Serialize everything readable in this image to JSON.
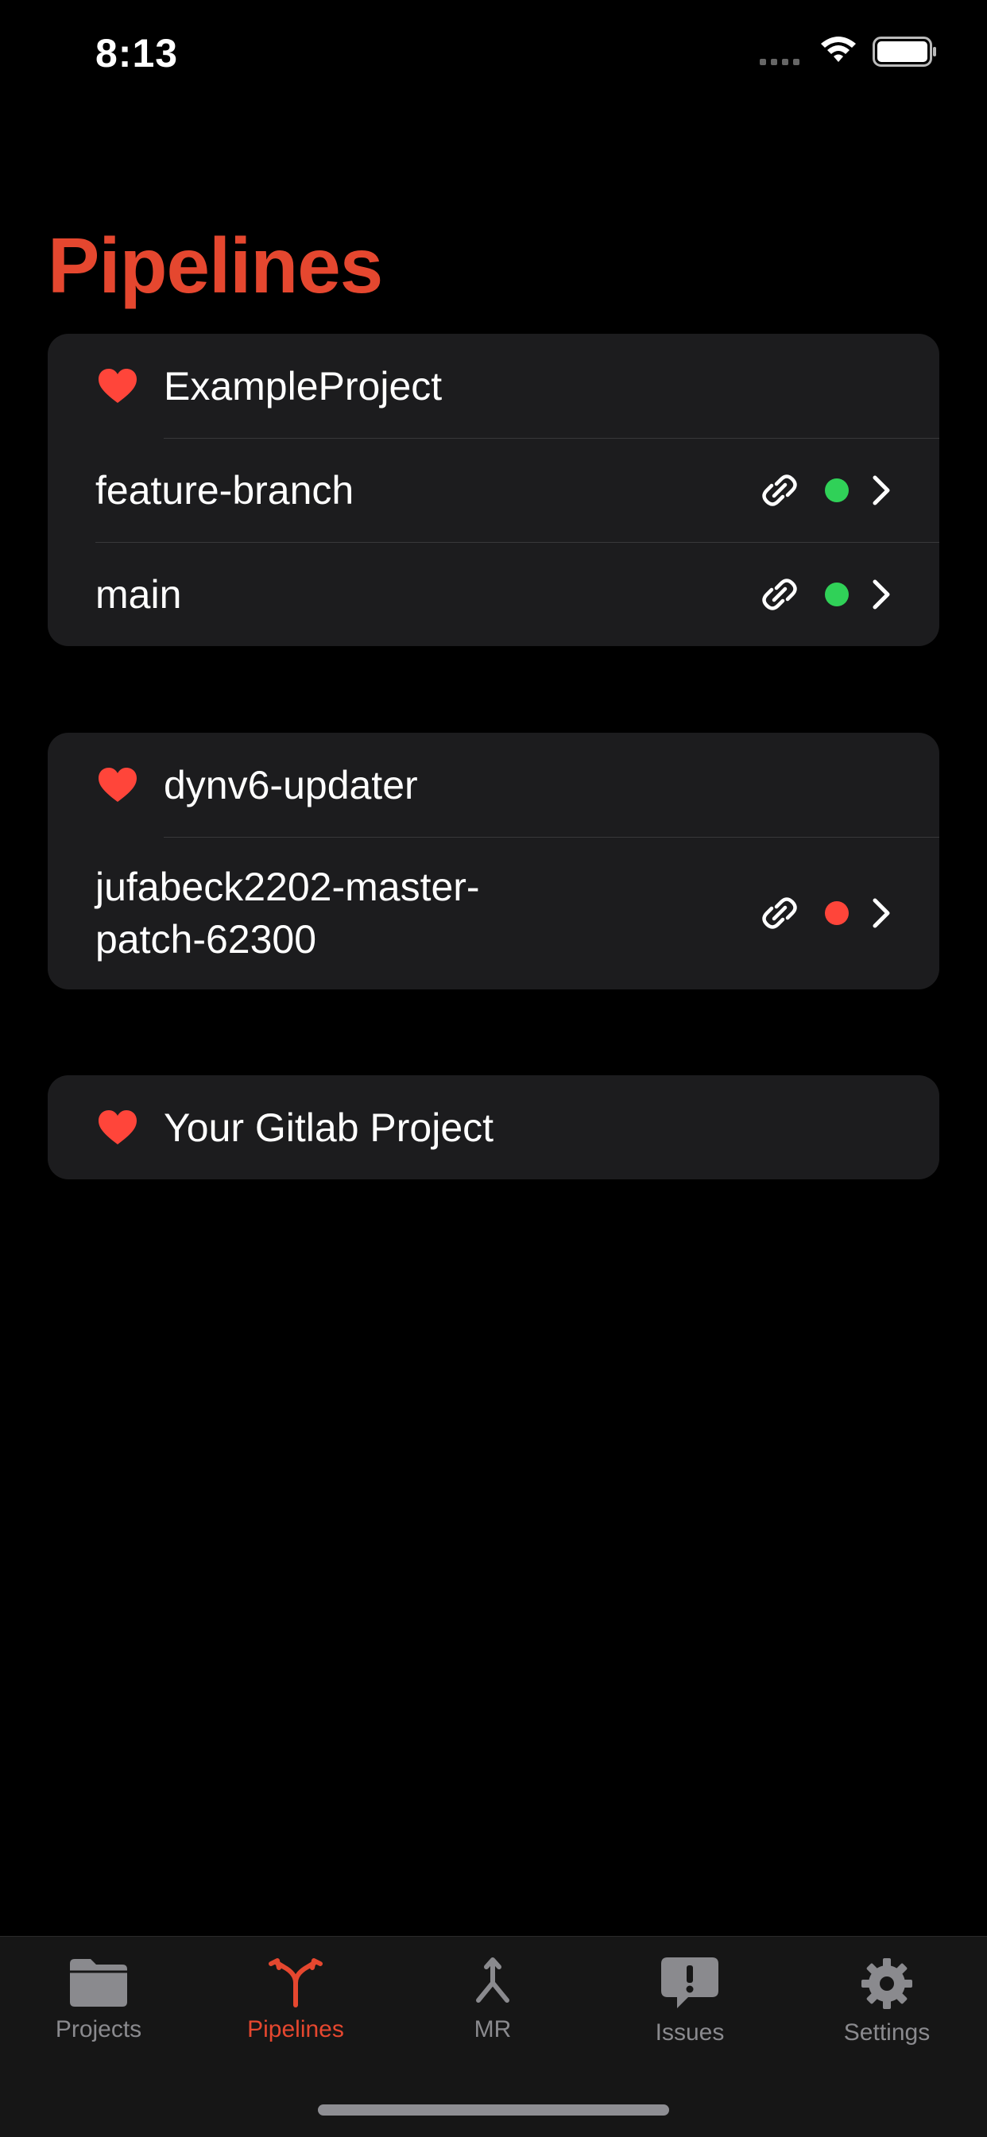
{
  "status_bar": {
    "time": "8:13"
  },
  "page": {
    "title": "Pipelines"
  },
  "colors": {
    "accent": "#e5472f",
    "success": "#30d158",
    "failed": "#ff453a",
    "heart": "#ff453a",
    "card": "#1c1c1e"
  },
  "projects": [
    {
      "name": "ExampleProject",
      "favorite": true,
      "branches": [
        {
          "name": "feature-branch",
          "status": "success"
        },
        {
          "name": "main",
          "status": "success"
        }
      ]
    },
    {
      "name": "dynv6-updater",
      "favorite": true,
      "branches": [
        {
          "name_line1": "jufabeck2202-master-",
          "name_line2": "patch-62300",
          "status": "failed"
        }
      ]
    },
    {
      "name": "Your Gitlab Project",
      "favorite": true,
      "branches": []
    }
  ],
  "tabbar": {
    "items": [
      {
        "label": "Projects",
        "icon": "folder-icon"
      },
      {
        "label": "Pipelines",
        "icon": "pipeline-icon",
        "active": true
      },
      {
        "label": "MR",
        "icon": "merge-icon"
      },
      {
        "label": "Issues",
        "icon": "issue-icon"
      },
      {
        "label": "Settings",
        "icon": "gear-icon"
      }
    ]
  }
}
